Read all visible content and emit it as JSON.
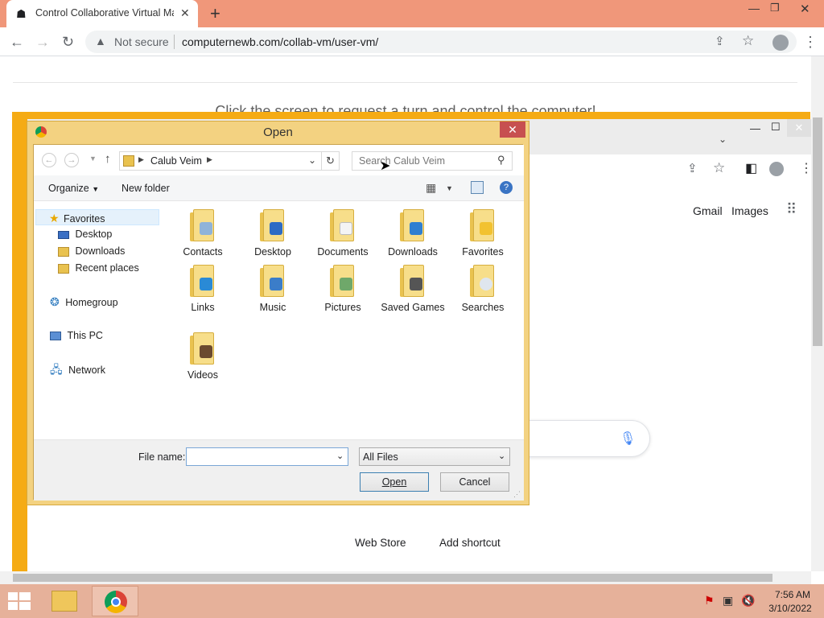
{
  "browser": {
    "tab_title": "Control Collaborative Virtual Ma",
    "security": "Not secure",
    "url": "computernewb.com/collab-vm/user-vm/"
  },
  "page": {
    "message": "Click the screen to request a turn and control the computer!"
  },
  "vm_browser": {
    "links": [
      "Gmail",
      "Images"
    ],
    "shortcuts": [
      "Web Store",
      "Add shortcut"
    ]
  },
  "dialog": {
    "title": "Open",
    "breadcrumb": "Calub Veim",
    "search_placeholder": "Search Calub Veim",
    "organize": "Organize",
    "new_folder": "New folder",
    "nav": {
      "favorites": "Favorites",
      "fav_items": [
        "Desktop",
        "Downloads",
        "Recent places"
      ],
      "homegroup": "Homegroup",
      "this_pc": "This PC",
      "network": "Network"
    },
    "folders": [
      "Contacts",
      "Desktop",
      "Documents",
      "Downloads",
      "Favorites",
      "Links",
      "Music",
      "Pictures",
      "Saved Games",
      "Searches",
      "Videos"
    ],
    "file_name_label": "File name:",
    "file_name_value": "",
    "file_type": "All Files",
    "open_button": "Open",
    "cancel_button": "Cancel"
  },
  "taskbar": {
    "time": "7:56 AM",
    "date": "3/10/2022"
  },
  "colors": {
    "tab_strip": "#f0977a",
    "vm_frame": "#f5ab14",
    "dialog_frame": "#f3d281",
    "taskbar": "#e6b19a",
    "close_red": "#c75050"
  }
}
